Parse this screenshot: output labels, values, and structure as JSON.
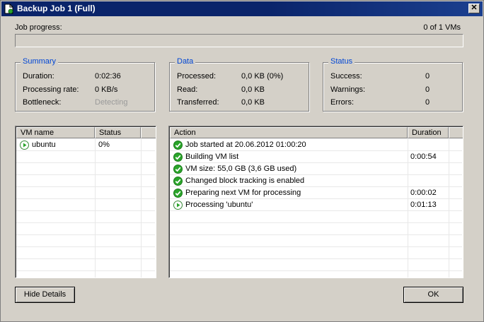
{
  "window": {
    "title": "Backup Job 1 (Full)",
    "close_glyph": "✕"
  },
  "progress": {
    "label": "Job progress:",
    "count_text": "0 of 1 VMs",
    "fraction": 0.0
  },
  "summary": {
    "title": "Summary",
    "rows": [
      {
        "label": "Duration:",
        "value": "0:02:36"
      },
      {
        "label": "Processing rate:",
        "value": "0 KB/s"
      },
      {
        "label": "Bottleneck:",
        "value": "Detecting"
      }
    ]
  },
  "data_group": {
    "title": "Data",
    "rows": [
      {
        "label": "Processed:",
        "value": "0,0 KB (0%)"
      },
      {
        "label": "Read:",
        "value": "0,0 KB"
      },
      {
        "label": "Transferred:",
        "value": "0,0 KB"
      }
    ]
  },
  "status_group": {
    "title": "Status",
    "rows": [
      {
        "label": "Success:",
        "value": "0"
      },
      {
        "label": "Warnings:",
        "value": "0"
      },
      {
        "label": "Errors:",
        "value": "0"
      }
    ]
  },
  "vm_list": {
    "columns": [
      "VM name",
      "Status"
    ],
    "rows": [
      {
        "icon": "play-icon",
        "name": "ubuntu",
        "status": "0%"
      }
    ]
  },
  "action_list": {
    "columns": [
      "Action",
      "Duration"
    ],
    "rows": [
      {
        "icon": "check-icon",
        "action": "Job started at 20.06.2012 01:00:20",
        "duration": ""
      },
      {
        "icon": "check-icon",
        "action": "Building VM list",
        "duration": "0:00:54"
      },
      {
        "icon": "check-icon",
        "action": "VM size: 55,0 GB (3,6 GB used)",
        "duration": ""
      },
      {
        "icon": "check-icon",
        "action": "Changed block tracking is enabled",
        "duration": ""
      },
      {
        "icon": "check-icon",
        "action": "Preparing next VM for processing",
        "duration": "0:00:02"
      },
      {
        "icon": "play-icon",
        "action": "Processing 'ubuntu'",
        "duration": "0:01:13"
      }
    ]
  },
  "buttons": {
    "hide_details": "Hide Details",
    "ok": "OK"
  },
  "colors": {
    "titlebar": "#0a246a",
    "group_title": "#0046d5",
    "check_green": "#2aa52a"
  }
}
